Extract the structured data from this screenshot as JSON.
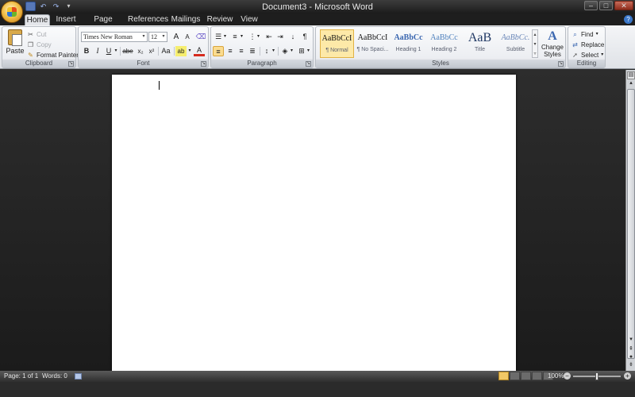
{
  "window": {
    "title": "Document3 - Microsoft Word",
    "controls": {
      "minimize": "–",
      "restore": "□",
      "close": "✕"
    }
  },
  "qat": {
    "save": "■",
    "undo": "↶",
    "redo": "↷",
    "customize": "▾"
  },
  "tabs": [
    "Home",
    "Insert",
    "Page Layout",
    "References",
    "Mailings",
    "Review",
    "View"
  ],
  "active_tab": "Home",
  "clipboard": {
    "label": "Clipboard",
    "paste": "Paste",
    "cut": "Cut",
    "copy": "Copy",
    "format_painter": "Format Painter"
  },
  "font": {
    "label": "Font",
    "family": "Times New Roman",
    "size": "12",
    "grow": "A",
    "shrink": "A",
    "clear": "✓",
    "bold": "B",
    "italic": "I",
    "underline": "U",
    "strike": "abe",
    "subscript": "x₂",
    "superscript": "x²",
    "change_case": "Aa",
    "highlight": "ab",
    "font_color": "A"
  },
  "paragraph": {
    "label": "Paragraph",
    "pilcrow": "¶",
    "sort": "↓"
  },
  "styles": {
    "label": "Styles",
    "items": [
      {
        "sample": "AaBbCcI",
        "name": "¶ Normal"
      },
      {
        "sample": "AaBbCcI",
        "name": "¶ No Spaci..."
      },
      {
        "sample": "AaBbCc",
        "name": "Heading 1"
      },
      {
        "sample": "AaBbCc",
        "name": "Heading 2"
      },
      {
        "sample": "AaB",
        "name": "Title"
      },
      {
        "sample": "AaBbCc.",
        "name": "Subtitle"
      }
    ],
    "change_styles": "Change Styles"
  },
  "editing": {
    "label": "Editing",
    "find": "Find",
    "replace": "Replace",
    "select": "Select"
  },
  "status": {
    "page": "Page: 1 of 1",
    "words": "Words: 0",
    "zoom": "100%",
    "zoom_minus": "−",
    "zoom_plus": "+"
  },
  "colors": {
    "accent_blue": "#3b67b0",
    "highlight_yellow": "#fbdc8f",
    "font_color_red": "#d52b1e"
  }
}
